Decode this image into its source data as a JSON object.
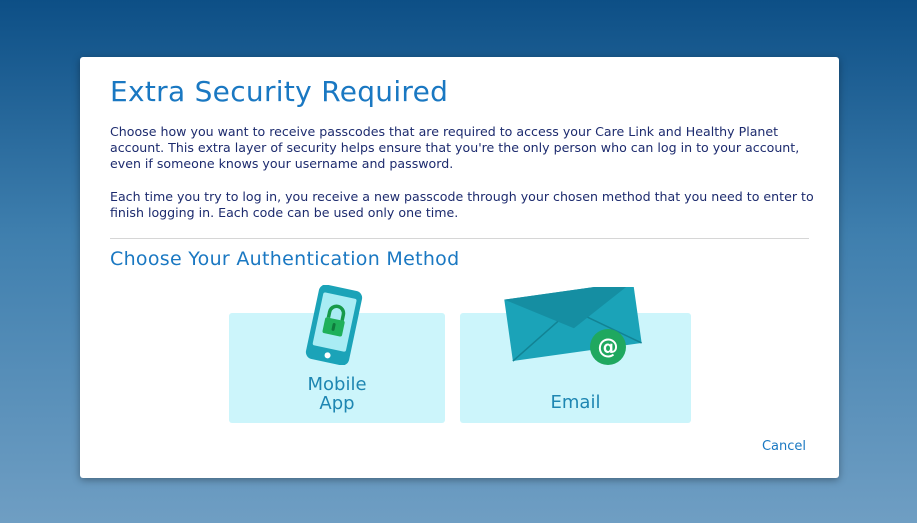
{
  "dialog": {
    "title": "Extra Security Required",
    "description_1": "Choose how you want to receive passcodes that are required to access your Care Link and Healthy Planet account. This extra layer of security helps ensure that you're the only person who can log in to your account, even if someone knows your username and password.",
    "description_2": "Each time you try to log in, you receive a new passcode through your chosen method that you need to enter to finish logging in. Each code can be used only one time.",
    "subtitle": "Choose Your Authentication Method",
    "methods": [
      {
        "label": "Mobile\nApp",
        "icon": "mobile-phone-lock-icon"
      },
      {
        "label": "Email",
        "icon": "envelope-at-icon"
      }
    ],
    "cancel_label": "Cancel"
  },
  "colors": {
    "accent": "#1a78c2",
    "tile_background": "#ccf5fb",
    "icon_teal": "#1ba3b8",
    "text_dark": "#1d2b6e"
  }
}
